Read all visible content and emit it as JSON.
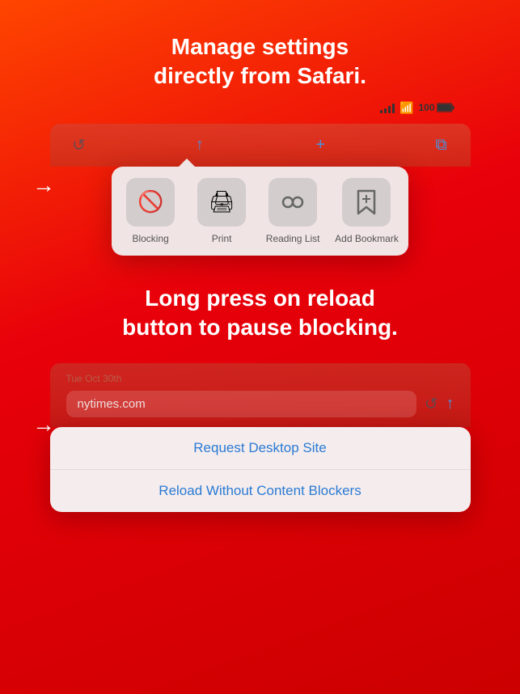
{
  "top_heading": {
    "line1": "Manage settings",
    "line2": "directly from Safari."
  },
  "safari_toolbar": {
    "reload_icon": "↺",
    "share_icon": "↑",
    "add_icon": "+",
    "tabs_icon": "⧉"
  },
  "status_bar": {
    "signal": "4 bars",
    "wifi": "wifi",
    "battery_percent": "100"
  },
  "context_menu_top": {
    "items": [
      {
        "label": "Blocking",
        "icon": "🚫"
      },
      {
        "label": "Print",
        "icon": "🖨"
      },
      {
        "label": "Reading List",
        "icon": "👓"
      },
      {
        "label": "Add Bookmark",
        "icon": "📖"
      }
    ]
  },
  "middle_heading": {
    "line1": "Long press on reload",
    "line2": "button to pause blocking."
  },
  "address_bar": {
    "date": "Tue Oct 30th",
    "url": "nytimes.com"
  },
  "context_menu_bottom": {
    "items": [
      {
        "label": "Request Desktop Site"
      },
      {
        "label": "Reload Without Content Blockers"
      }
    ]
  },
  "arrow": "→"
}
